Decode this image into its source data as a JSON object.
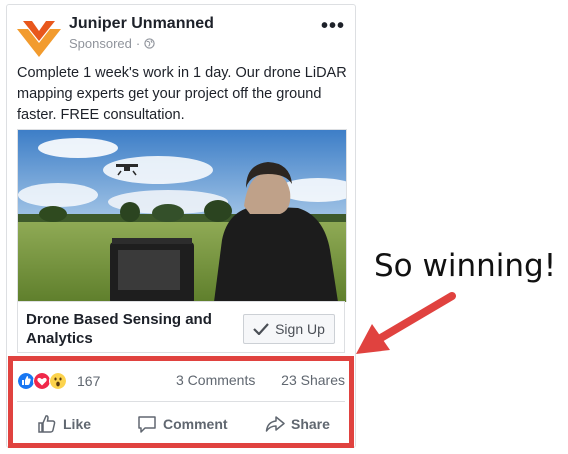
{
  "post": {
    "page_name": "Juniper Unmanned",
    "sponsored_label": "Sponsored",
    "separator": "·",
    "menu_icon": "more-options-icon",
    "text": "Complete 1 week's work in 1 day. Our drone LiDAR mapping experts get your project off the ground faster. FREE consultation.",
    "image_icon": "drone-photo",
    "link_title": "Drone Based Sensing and Analytics",
    "cta_label": "Sign Up",
    "reaction_count": "167",
    "comments_label": "3 Comments",
    "shares_label": "23 Shares",
    "actions": {
      "like": "Like",
      "comment": "Comment",
      "share": "Share"
    }
  },
  "annotation": {
    "text": "So winning!",
    "color": "#e0423f"
  },
  "colors": {
    "brand_orange": "#f29b2e",
    "like_blue": "#1877f2",
    "love_red": "#f0284a",
    "wow_yellow": "#fcd34d"
  }
}
